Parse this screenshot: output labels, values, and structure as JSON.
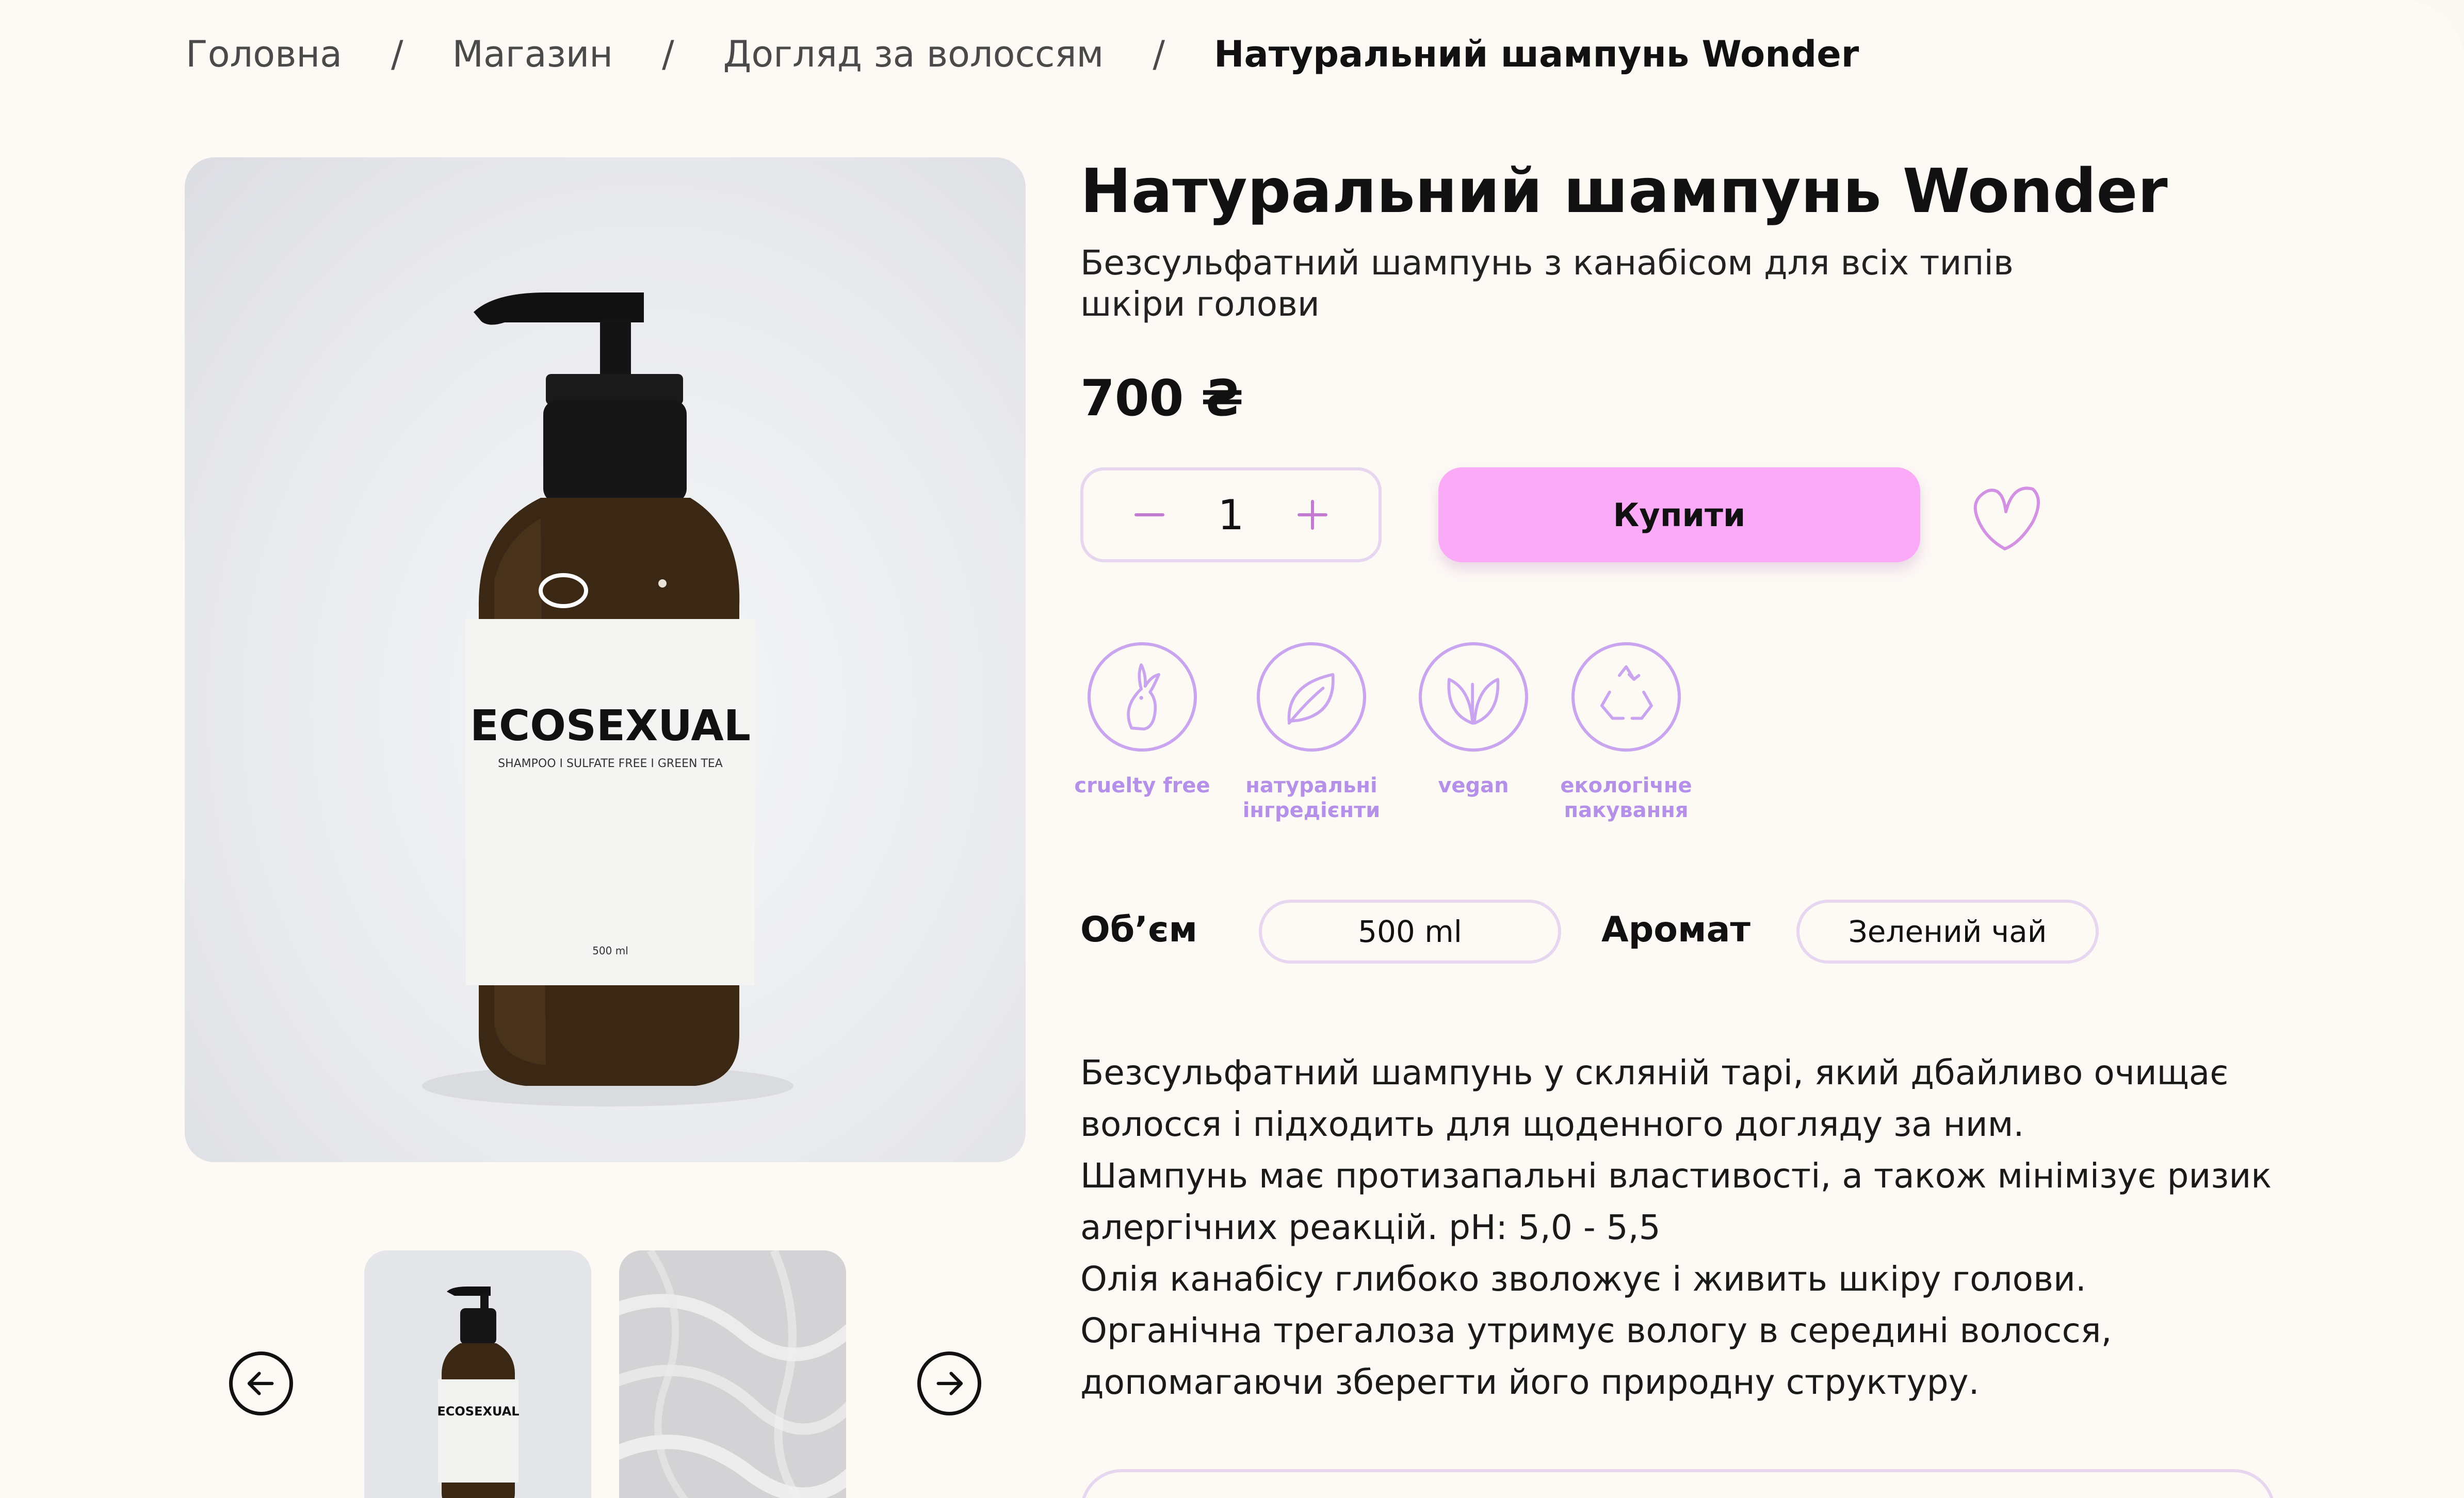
{
  "breadcrumb": {
    "items": [
      "Головна",
      "Магазин",
      "Догляд за волоссям"
    ],
    "current": "Натуральний шампунь Wonder",
    "separator": "/"
  },
  "product": {
    "title": "Натуральний шампунь Wonder",
    "subtitle": "Безсульфатний шампунь з канабісом для всіх типів шкіри голови",
    "price": "700 ₴",
    "quantity": "1",
    "buy_label": "Купити",
    "bottle_label": {
      "brand": "ECOSEXUAL",
      "line": "SHAMPOO I SULFATE FREE I GREEN TEA",
      "volume": "500 ml"
    }
  },
  "features": [
    {
      "label": "cruelty free",
      "icon": "rabbit-icon"
    },
    {
      "label": "натуральні інгредієнти",
      "icon": "leaf-icon"
    },
    {
      "label": "vegan",
      "icon": "vegan-leaf-icon"
    },
    {
      "label": "екологічне пакування",
      "icon": "recycle-icon"
    }
  ],
  "options": {
    "volume_label": "Об’єм",
    "volume_value": "500 ml",
    "aroma_label": "Аромат",
    "aroma_value": "Зелений чай"
  },
  "description": [
    "Безсульфатний шампунь у скляній тарі, який дбайливо очищає волосся і підходить для щоденного догляду за ним.",
    "Шампунь має протизапальні властивості, а також мінімізує ризик алергічних реакцій.  pH:  5,0 - 5,5",
    "Олія канабісу глибоко зволожує і живить шкіру голови.",
    "Органічна трегалоза утримує вологу в середині волосся, допомагаючи зберегти його природну структуру."
  ],
  "colors": {
    "background": "#fdf9f4",
    "accent_pink": "#fbaaf8",
    "accent_purple": "#b590e8",
    "border_lilac": "#e6d6f0"
  }
}
